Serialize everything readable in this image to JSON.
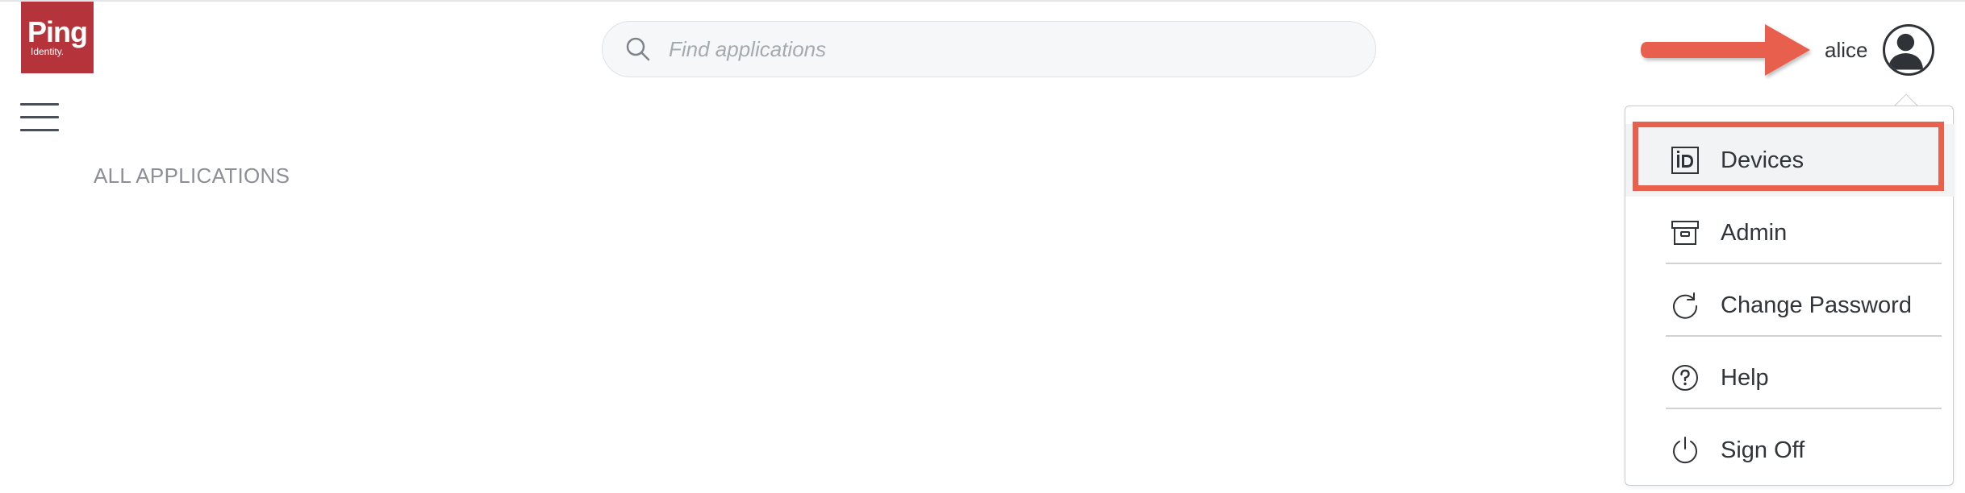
{
  "brand": {
    "logo_word": "Ping",
    "logo_sub": "Identity."
  },
  "search": {
    "placeholder": "Find applications",
    "value": ""
  },
  "main": {
    "section_heading": "ALL APPLICATIONS"
  },
  "user": {
    "username": "alice"
  },
  "user_menu": {
    "items": [
      {
        "label": "Devices",
        "icon": "id-card-icon"
      },
      {
        "label": "Admin",
        "icon": "archive-box-icon"
      },
      {
        "label": "Change Password",
        "icon": "refresh-icon"
      },
      {
        "label": "Help",
        "icon": "question-circle-icon"
      },
      {
        "label": "Sign Off",
        "icon": "power-icon"
      }
    ]
  },
  "colors": {
    "brand_red": "#b5343b",
    "annotation_red": "#e8614d",
    "text_dark": "#30353a",
    "muted_gray": "#8c9095"
  }
}
